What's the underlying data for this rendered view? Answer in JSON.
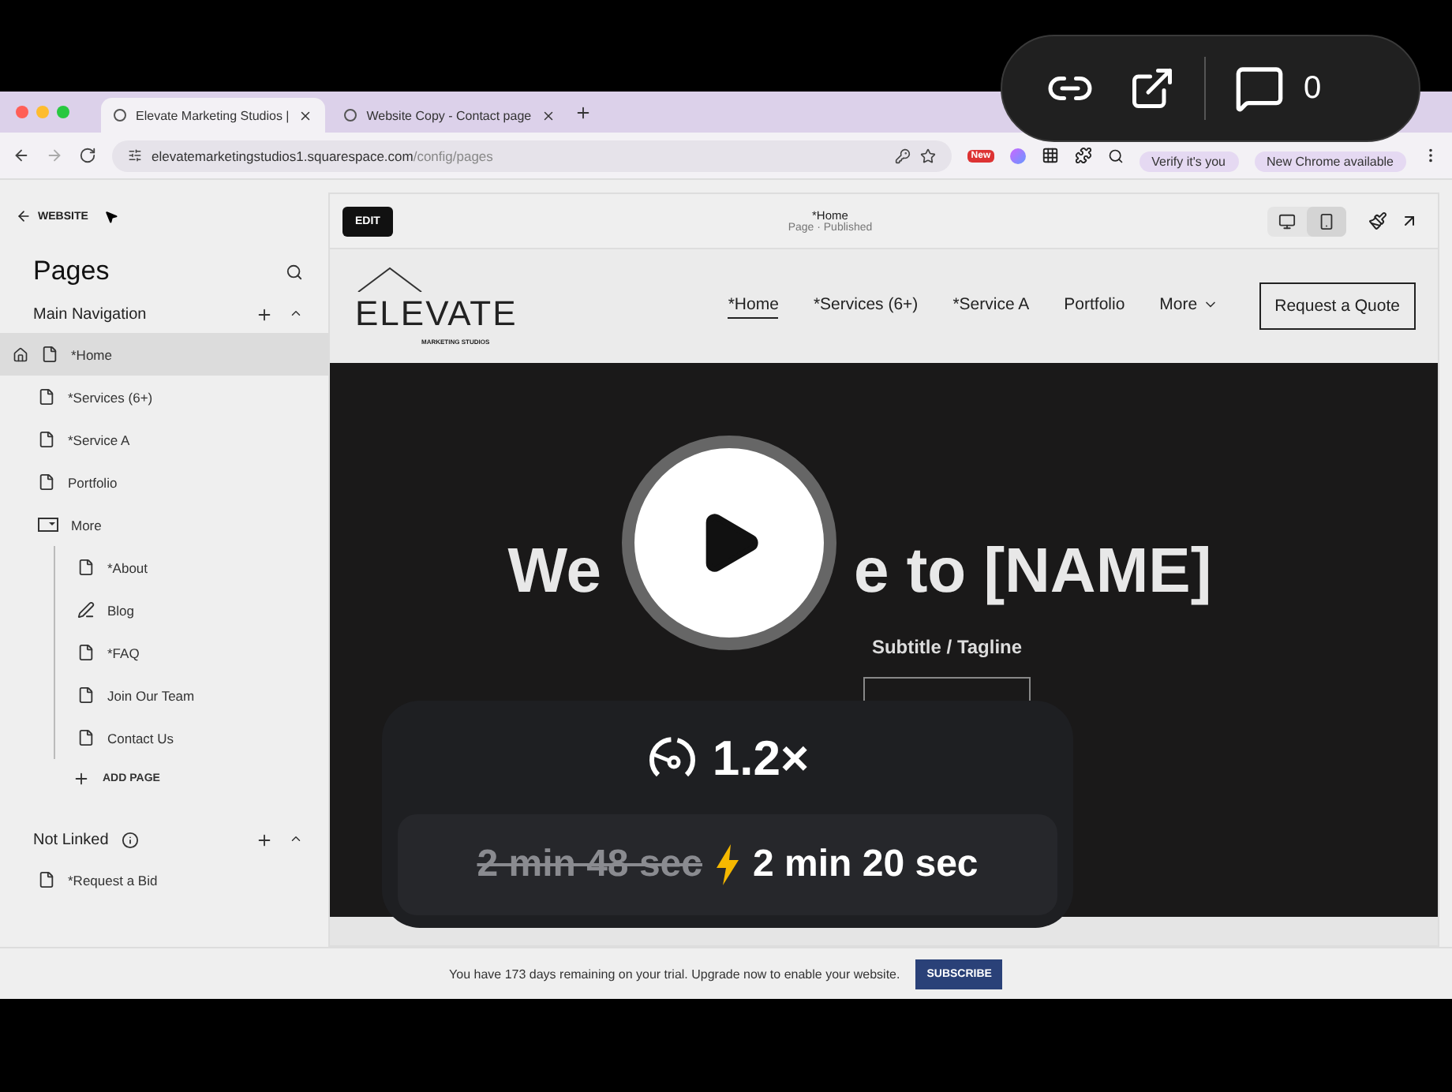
{
  "browser": {
    "tabs": [
      {
        "title": "Elevate Marketing Studios |",
        "selected": true
      },
      {
        "title": "Website Copy - Contact page",
        "selected": false
      }
    ],
    "url_host": "elevatemarketingstudios1.squarespace.com",
    "url_path": "/config/pages",
    "extension_badge": "New",
    "profile_chip": "Verify it's you",
    "update_chip": "New Chrome available"
  },
  "sidebar": {
    "back_link": "WEBSITE",
    "title": "Pages",
    "sections": [
      {
        "title": "Main Navigation",
        "info": false,
        "add_label": "ADD PAGE",
        "items": [
          {
            "label": "*Home",
            "kind": "page",
            "selected": true,
            "home": true
          },
          {
            "label": "*Services (6+)",
            "kind": "page",
            "selected": false,
            "home": false
          },
          {
            "label": "*Service A",
            "kind": "page",
            "selected": false,
            "home": false
          },
          {
            "label": "Portfolio",
            "kind": "page",
            "selected": false,
            "home": false
          },
          {
            "label": "More",
            "kind": "folder",
            "selected": false,
            "home": false,
            "children": [
              {
                "label": "*About",
                "kind": "page",
                "selected": false,
                "home": false
              },
              {
                "label": "Blog",
                "kind": "blog",
                "selected": false,
                "home": false
              },
              {
                "label": "*FAQ",
                "kind": "page",
                "selected": false,
                "home": false
              },
              {
                "label": "Join Our Team",
                "kind": "page",
                "selected": false,
                "home": false
              },
              {
                "label": "Contact Us",
                "kind": "page",
                "selected": false,
                "home": false
              }
            ]
          }
        ]
      },
      {
        "title": "Not Linked",
        "info": true,
        "items": [
          {
            "label": "*Request a Bid",
            "kind": "page",
            "selected": false,
            "home": false
          }
        ]
      }
    ]
  },
  "editor": {
    "edit_button": "EDIT",
    "page_title": "*Home",
    "page_status": "Page · Published",
    "devices": [
      {
        "kind": "desktop",
        "selected": false
      },
      {
        "kind": "mobile",
        "selected": true
      }
    ]
  },
  "site": {
    "logo": {
      "name": "ELEVATE",
      "tagline": "MARKETING STUDIOS"
    },
    "nav": [
      {
        "label": "*Home",
        "kind": "link",
        "selected": true
      },
      {
        "label": "*Services (6+)",
        "kind": "link",
        "selected": false
      },
      {
        "label": "*Service A",
        "kind": "link",
        "selected": false
      },
      {
        "label": "Portfolio",
        "kind": "link",
        "selected": false
      },
      {
        "label": "More",
        "kind": "dropdown",
        "selected": false
      }
    ],
    "cta": "Request a Quote",
    "hero": {
      "heading_parts": [
        "We",
        "e to [NAME]"
      ],
      "subtitle": "Subtitle / Tagline"
    }
  },
  "trial_bar": {
    "message": "You have 173 days remaining on your trial. Upgrade now to enable your website.",
    "button": "SUBSCRIBE"
  },
  "video_controls": {
    "comment_count": "0"
  },
  "speed_overlay": {
    "speed": "1.2×",
    "original_duration": "2 min 48 sec",
    "new_duration": "2 min 20 sec"
  }
}
